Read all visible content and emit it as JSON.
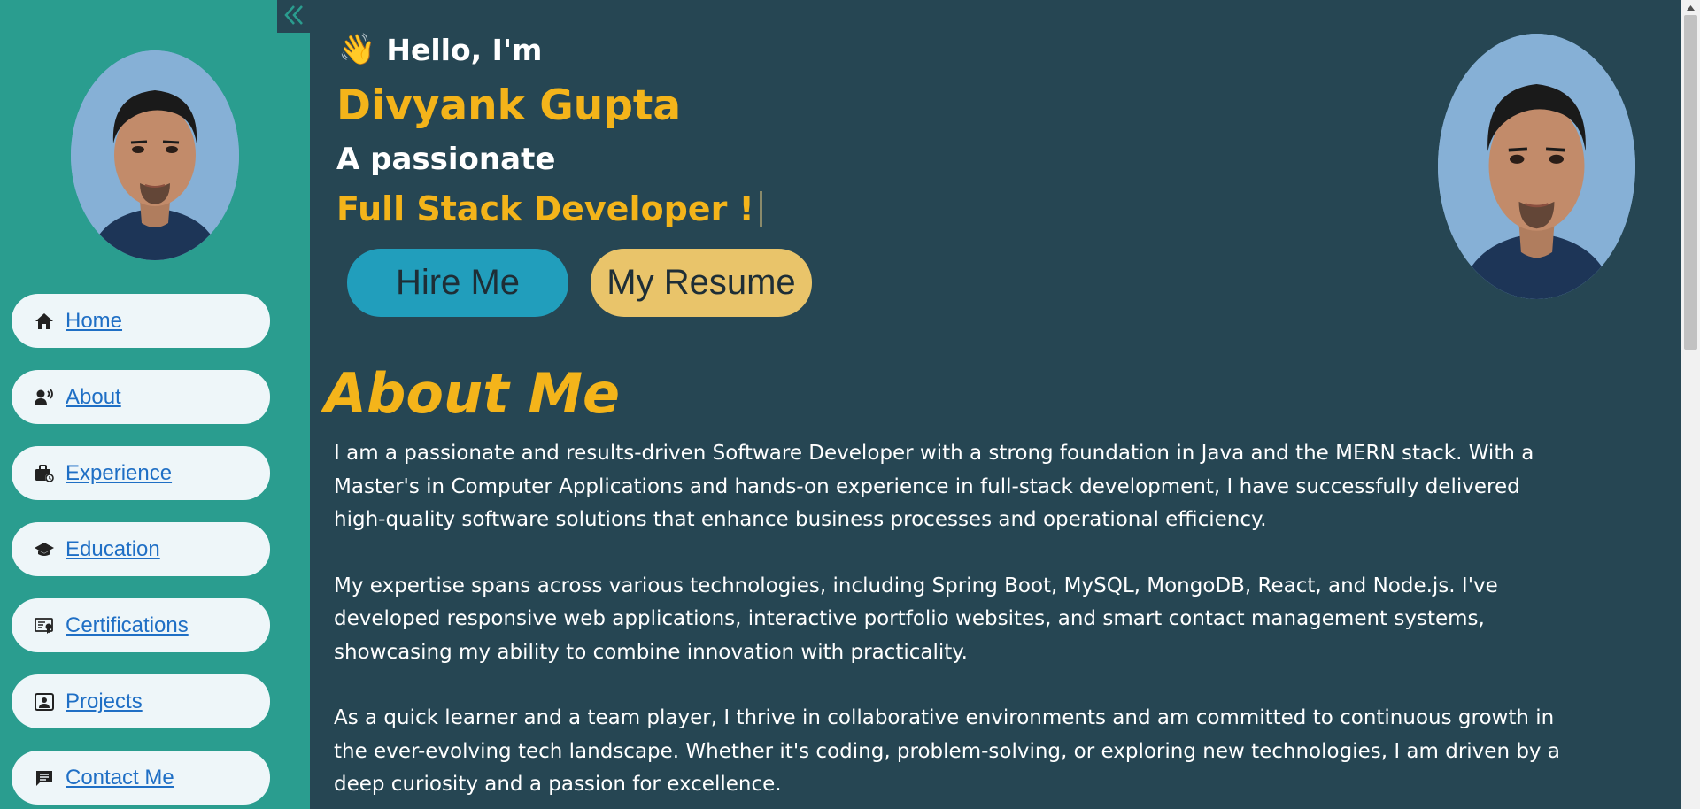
{
  "sidebar": {
    "avatar_alt": "Profile photo",
    "items": [
      {
        "label": "Home",
        "icon": "home-icon"
      },
      {
        "label": "About",
        "icon": "speaking-person-icon"
      },
      {
        "label": "Experience",
        "icon": "briefcase-icon"
      },
      {
        "label": "Education",
        "icon": "graduation-cap-icon"
      },
      {
        "label": "Certifications",
        "icon": "certificate-icon"
      },
      {
        "label": "Projects",
        "icon": "projects-icon"
      },
      {
        "label": "Contact Me",
        "icon": "chat-icon"
      }
    ],
    "collapse_icon": "double-chevron-left-icon"
  },
  "hero": {
    "greeting_emoji": "👋",
    "greeting": "Hello, I'm",
    "name": "Divyank Gupta",
    "tagline": "A passionate",
    "role": "Full Stack Developer !",
    "buttons": {
      "hire": "Hire Me",
      "resume": "My Resume"
    }
  },
  "about": {
    "title": "About Me",
    "paragraphs": [
      "I am a passionate and results-driven Software Developer with a strong foundation in Java and the MERN stack. With a Master's in Computer Applications and hands-on experience in full-stack development, I have successfully delivered high-quality software solutions that enhance business processes and operational efficiency.",
      "My expertise spans across various technologies, including Spring Boot, MySQL, MongoDB, React, and Node.js. I've developed responsive web applications, interactive portfolio websites, and smart contact management systems, showcasing my ability to combine innovation with practicality.",
      "As a quick learner and a team player, I thrive in collaborative environments and am committed to continuous growth in the ever-evolving tech landscape. Whether it's coding, problem-solving, or exploring new technologies, I am driven by a deep curiosity and a passion for excellence."
    ]
  },
  "colors": {
    "background": "#264653",
    "sidebar": "#2a9d8f",
    "accent": "#f4b41a",
    "hire_button": "#219ebc",
    "resume_button": "#e9c46a"
  }
}
